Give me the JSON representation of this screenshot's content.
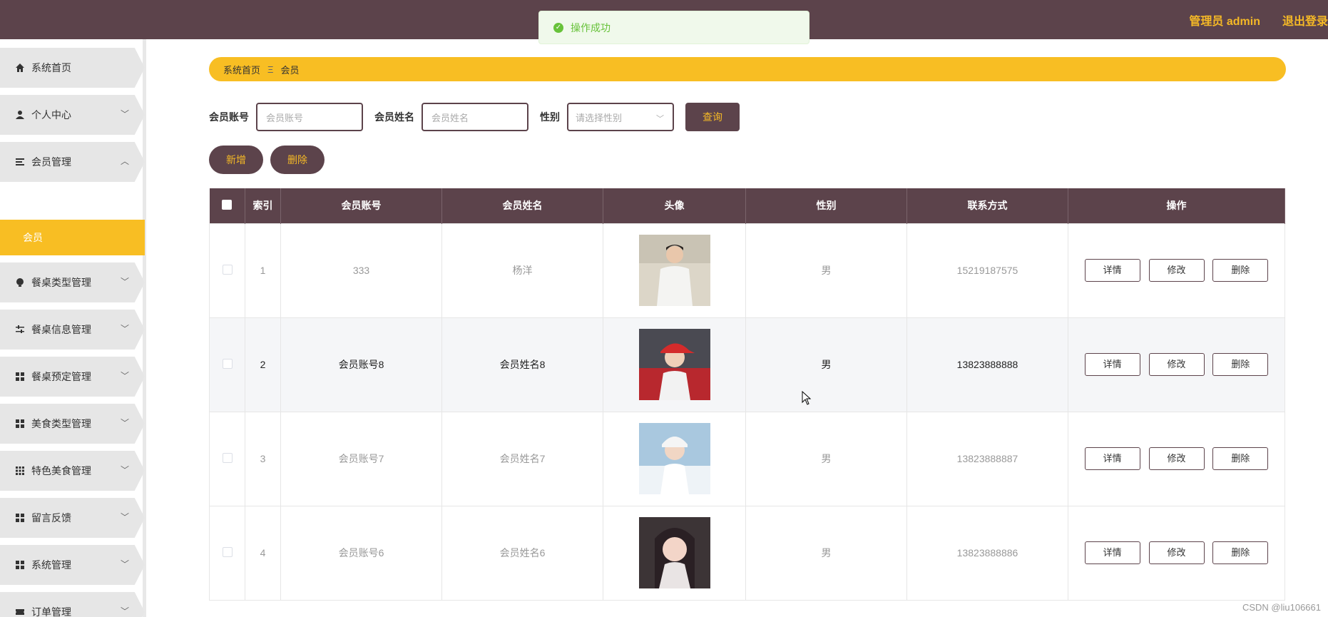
{
  "header": {
    "user_label": "管理员 admin",
    "logout_label": "退出登录"
  },
  "toast": {
    "message": "操作成功"
  },
  "sidebar": {
    "items": [
      {
        "label": "系统首页",
        "icon": "home-icon"
      },
      {
        "label": "个人中心",
        "icon": "user-icon"
      },
      {
        "label": "会员管理",
        "icon": "list-icon",
        "expanded": true
      },
      {
        "label": "餐桌类型管理",
        "icon": "bulb-icon"
      },
      {
        "label": "餐桌信息管理",
        "icon": "sliders-icon"
      },
      {
        "label": "餐桌预定管理",
        "icon": "grid-icon"
      },
      {
        "label": "美食类型管理",
        "icon": "grid-icon"
      },
      {
        "label": "特色美食管理",
        "icon": "apps-icon"
      },
      {
        "label": "留言反馈",
        "icon": "grid-icon"
      },
      {
        "label": "系统管理",
        "icon": "grid-icon"
      },
      {
        "label": "订单管理",
        "icon": "ticket-icon"
      }
    ],
    "submenu_active": "会员"
  },
  "breadcrumb": {
    "home": "系统首页",
    "current": "会员"
  },
  "search": {
    "account_label": "会员账号",
    "account_placeholder": "会员账号",
    "name_label": "会员姓名",
    "name_placeholder": "会员姓名",
    "gender_label": "性别",
    "gender_placeholder": "请选择性别",
    "query_button": "查询"
  },
  "actions": {
    "add": "新增",
    "delete": "删除"
  },
  "table": {
    "columns": [
      "索引",
      "会员账号",
      "会员姓名",
      "头像",
      "性别",
      "联系方式",
      "操作"
    ],
    "rows": [
      {
        "index": "1",
        "account": "333",
        "name": "杨洋",
        "gender": "男",
        "phone": "15219187575"
      },
      {
        "index": "2",
        "account": "会员账号8",
        "name": "会员姓名8",
        "gender": "男",
        "phone": "13823888888"
      },
      {
        "index": "3",
        "account": "会员账号7",
        "name": "会员姓名7",
        "gender": "男",
        "phone": "13823888887"
      },
      {
        "index": "4",
        "account": "会员账号6",
        "name": "会员姓名6",
        "gender": "男",
        "phone": "13823888886"
      }
    ],
    "row_actions": {
      "detail": "详情",
      "edit": "修改",
      "delete": "删除"
    }
  },
  "watermark": "CSDN @liu106661",
  "colors": {
    "primary": "#5c434b",
    "accent": "#f8be23",
    "success": "#67c23a"
  }
}
